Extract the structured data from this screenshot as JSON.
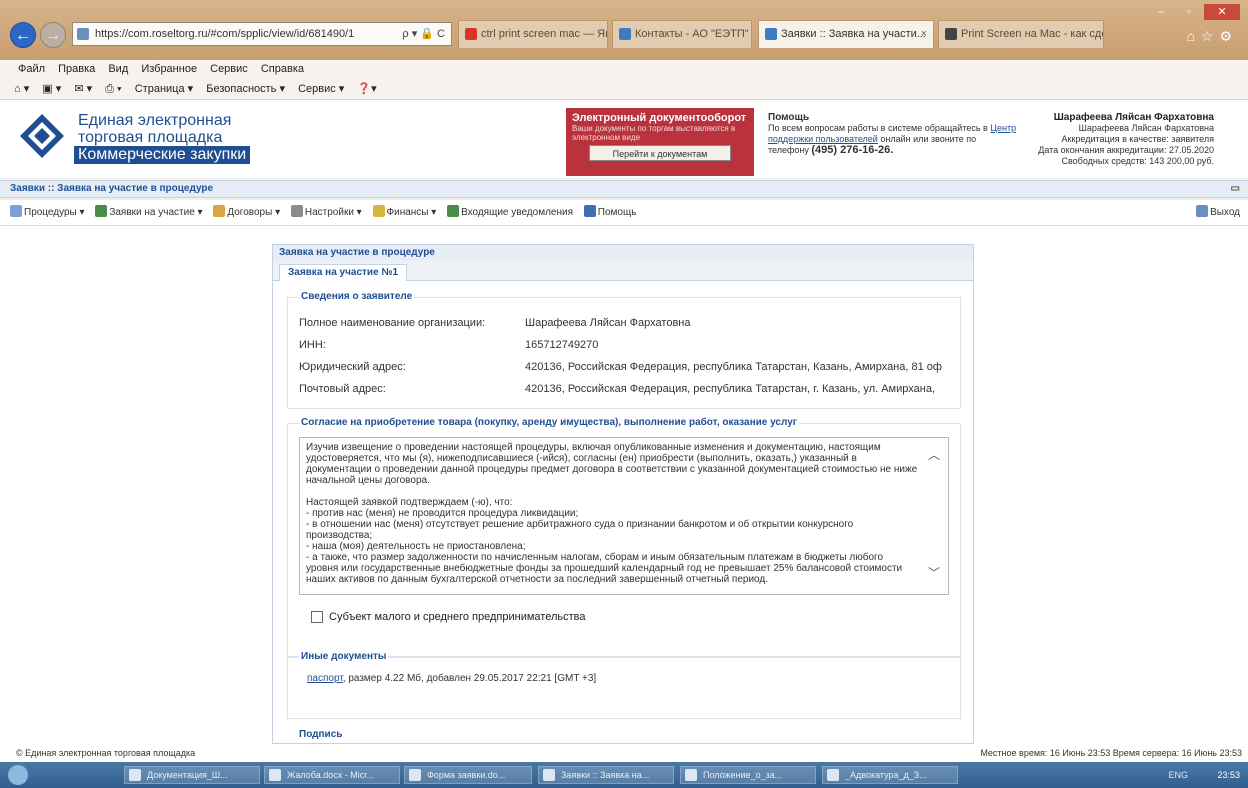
{
  "browser": {
    "url": "https://com.roseltorg.ru/#com/spplic/view/id/681490/1",
    "url_controls": "ρ ▾ 🔒 C",
    "tabs": [
      {
        "label": "ctrl print screen mac — Яндек...",
        "active": false
      },
      {
        "label": "Контакты - АО \"ЕЭТП\"",
        "active": false
      },
      {
        "label": "Заявки :: Заявка на участи...",
        "active": true
      },
      {
        "label": "Print Screen на Mac - как сдел...",
        "active": false
      }
    ],
    "menu": [
      "Файл",
      "Правка",
      "Вид",
      "Избранное",
      "Сервис",
      "Справка"
    ],
    "commands": [
      "Страница ▾",
      "Безопасность ▾",
      "Сервис ▾"
    ]
  },
  "header": {
    "logo_line1": "Единая электронная",
    "logo_line2": "торговая площадка",
    "logo_line3": "Коммерческие закупки",
    "edo_title": "Электронный документооборот",
    "edo_sub": "Ваши документы по торгам выставляются в электронном виде",
    "edo_button": "Перейти к документам",
    "help_title": "Помощь",
    "help_text": "По всем вопросам работы в системе обращайтесь в",
    "help_link": "Центр поддержки пользователей",
    "help_text2": "онлайн или звоните по телефону",
    "help_phone": "(495) 276-16-26.",
    "user_name": "Шарафеева Ляйсан Фархатовна",
    "user_name2": "Шарафеева Ляйсан Фархатовна",
    "accreditation": "Аккредитация в качестве: заявителя",
    "accr_end": "Дата окончания аккредитации: 27.05.2020",
    "funds": "Свободных средств: 143 200,00 руб."
  },
  "breadcrumb": "Заявки :: Заявка на участие в процедуре",
  "toolbar": {
    "items": [
      "Процедуры ▾",
      "Заявки на участие ▾",
      "Договоры ▾",
      "Настройки ▾",
      "Финансы ▾",
      "Входящие уведомления",
      "Помощь"
    ],
    "exit": "Выход"
  },
  "panel": {
    "title": "Заявка на участие в процедуре",
    "tab": "Заявка на участие №1",
    "applicant_legend": "Сведения о заявителе",
    "fields": [
      {
        "label": "Полное наименование организации:",
        "value": "Шарафеева Ляйсан Фархатовна"
      },
      {
        "label": "ИНН:",
        "value": "165712749270"
      },
      {
        "label": "Юридический адрес:",
        "value": "420136, Российская Федерация, республика Татарстан, Казань, Амирхана, 81 оф"
      },
      {
        "label": "Почтовый адрес:",
        "value": "420136, Российская Федерация, республика Татарстан, г. Казань, ул. Амирхана,"
      }
    ],
    "consent_legend": "Согласие на приобретение товара (покупку, аренду имущества), выполнение работ, оказание услуг",
    "consent_p1": "Изучив извещение о проведении настоящей процедуры, включая опубликованные изменения и документацию, настоящим удостоверяется, что мы (я), нижеподписавшиеся (-ийся), согласны (ен) приобрести (выполнить, оказать,) указанный в документации о проведении данной процедуры предмет договора в соответствии с указанной документацией стоимостью не ниже начальной цены договора.",
    "consent_p2": "Настоящей заявкой подтверждаем (-ю), что:",
    "consent_l1": " - против нас (меня) не проводится процедура ликвидации;",
    "consent_l2": " - в отношении нас (меня) отсутствует решение арбитражного суда о признании банкротом и об открытии конкурсного производства;",
    "consent_l3": " - наша (моя) деятельность не приостановлена;",
    "consent_l4": " - а также, что размер задолженности по начисленным налогам, сборам и иным обязательным платежам в бюджеты любого уровня или государственные внебюджетные фонды за прошедший календарный год не превышает 25% балансовой стоимости наших активов по данным бухгалтерской отчетности за последний завершенный отчетный период.",
    "sme_label": "Субъект малого и среднего предпринимательства",
    "docs_legend": "Иные документы",
    "doc_link": "паспорт",
    "doc_info": ", размер 4.22 Мб, добавлен 29.05.2017 22:21 [GMT +3]",
    "sign_legend": "Подпись"
  },
  "status": {
    "left": "© Единая электронная торговая площадка",
    "right": "Местное время: 16 Июнь 23:53 Время сервера: 16 Июнь 23:53"
  },
  "taskbar": {
    "buttons": [
      "Документация_Ш...",
      "Жалоба.docx - Micr...",
      "Форма заявки.do...",
      "Заявки :: Заявка на...",
      "Положение_о_за...",
      "_Адвокатура_д_З..."
    ],
    "lang": "ENG",
    "clock": "23:53"
  }
}
